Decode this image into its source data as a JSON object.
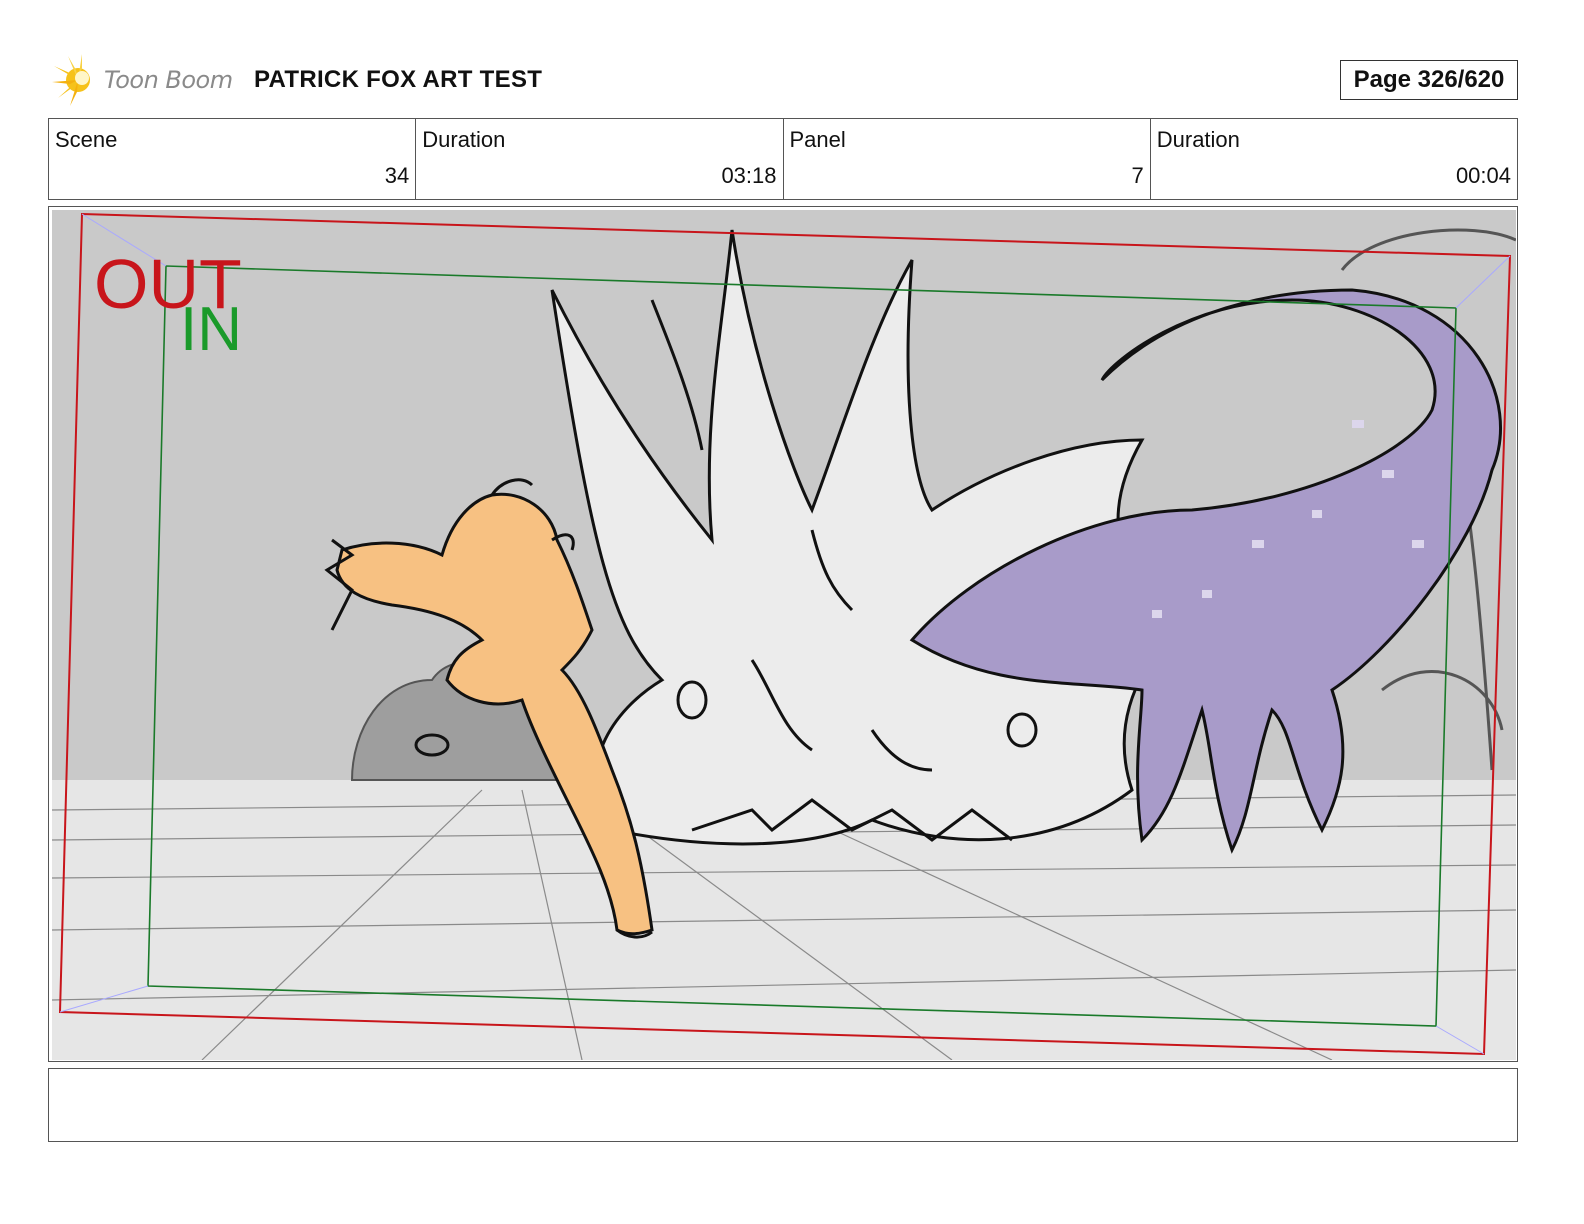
{
  "header": {
    "logo_text": "Toon Boom",
    "project_title": "PATRICK FOX ART TEST",
    "page_label": "Page 326/620"
  },
  "info": {
    "scene_label": "Scene",
    "scene_value": "34",
    "scene_duration_label": "Duration",
    "scene_duration_value": "03:18",
    "panel_label": "Panel",
    "panel_value": "7",
    "panel_duration_label": "Duration",
    "panel_duration_value": "00:04"
  },
  "panel": {
    "out_label": "OUT",
    "in_label": "IN",
    "out_color": "#c8151b",
    "in_color": "#1a9a2a",
    "sky_color": "#c9c9c9",
    "floor_color": "#e4e4e4",
    "character_color": "#f7c182",
    "creature_color": "#a89bc9",
    "explosion_color": "#ececec"
  },
  "dialogue": {
    "text": ""
  }
}
